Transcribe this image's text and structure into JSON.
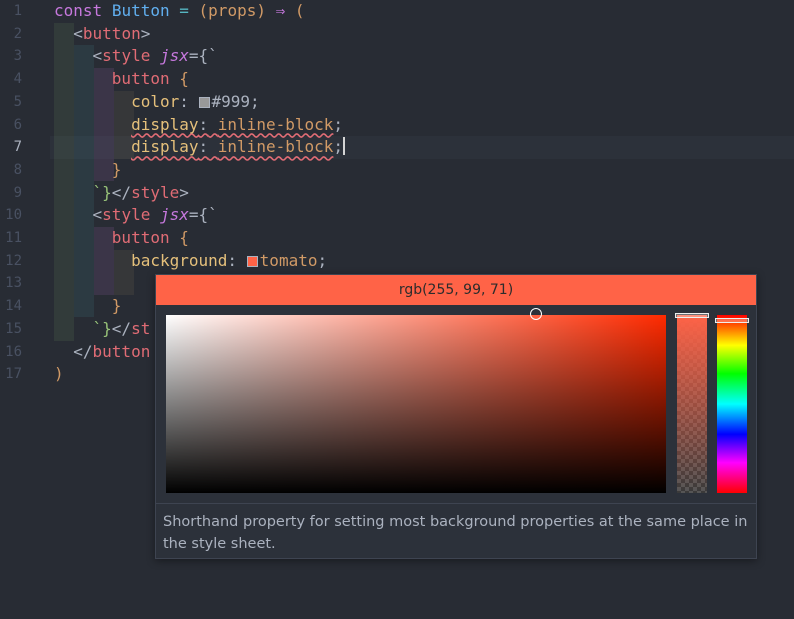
{
  "editor": {
    "line_numbers": [
      "1",
      "2",
      "3",
      "4",
      "5",
      "6",
      "7",
      "8",
      "9",
      "10",
      "11",
      "12",
      "13",
      "14",
      "15",
      "16",
      "17"
    ],
    "active_line": 7,
    "code": {
      "l1": {
        "kw": "const",
        "name": "Button",
        "eq": "=",
        "lp": "(",
        "param": "props",
        "rp": ")",
        "arrow": "⇒",
        "open": "("
      },
      "l2": {
        "tag_open": "<",
        "tag": "button",
        "tag_close": ">"
      },
      "l3": {
        "tag_open": "<",
        "tag": "style",
        "attr": "jsx",
        "tail": "={`"
      },
      "l4": {
        "sel": "button",
        "brace": "{"
      },
      "l5": {
        "prop": "color",
        "colon": ":",
        "value": "#999",
        "semi": ";"
      },
      "l6": {
        "prop": "display",
        "colon": ":",
        "value": "inline-block",
        "semi": ";"
      },
      "l7": {
        "prop": "display",
        "colon": ":",
        "value": "inline-block",
        "semi": ";"
      },
      "l8": {
        "brace": "}"
      },
      "l9": {
        "tick": "`}",
        "close_open": "</",
        "tag": "style",
        "close_end": ">"
      },
      "l10": {
        "tag_open": "<",
        "tag": "style",
        "attr": "jsx",
        "tail": "={`"
      },
      "l11": {
        "sel": "button",
        "brace": "{"
      },
      "l12": {
        "prop": "background",
        "colon": ":",
        "value": "tomato",
        "semi": ";"
      },
      "l14": {
        "brace": "}"
      },
      "l15": {
        "tick": "`}",
        "close_open": "</",
        "tag": "st"
      },
      "l16": {
        "close_open": "</",
        "tag": "button"
      },
      "l17": {
        "paren": ")"
      }
    }
  },
  "color_picker": {
    "value": "rgb(255, 99, 71)",
    "hue_color": "#ff2a00",
    "selected_color": "#ff6347",
    "swatch_999": "#999999",
    "description": "Shorthand property for setting most background properties at the same place in the style sheet."
  }
}
